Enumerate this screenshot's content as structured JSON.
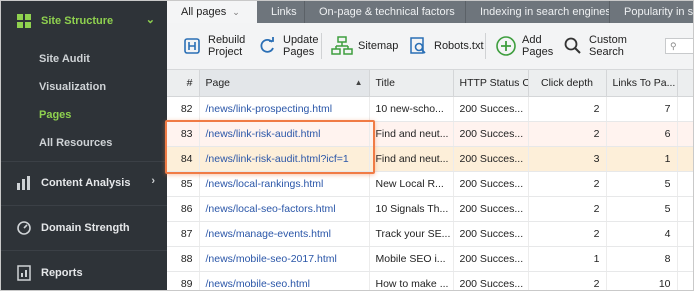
{
  "colors": {
    "accent_green": "#8fd14f",
    "highlight_orange": "#f07b45",
    "link_blue": "#2a56a8",
    "sidebar_bg": "#2e3338"
  },
  "sidebar": {
    "site_structure": {
      "label": "Site Structure",
      "icon": "sitemap-icon"
    },
    "items": [
      {
        "label": "Site Audit",
        "active": false
      },
      {
        "label": "Visualization",
        "active": false
      },
      {
        "label": "Pages",
        "active": true
      },
      {
        "label": "All Resources",
        "active": false
      }
    ],
    "content_analysis": {
      "label": "Content Analysis",
      "icon": "bar-chart-icon"
    },
    "domain_strength": {
      "label": "Domain Strength",
      "icon": "gauge-icon"
    },
    "reports": {
      "label": "Reports",
      "icon": "report-icon"
    }
  },
  "tabs": [
    {
      "label": "All pages",
      "active": true
    },
    {
      "label": "Links"
    },
    {
      "label": "On-page & technical factors"
    },
    {
      "label": "Indexing in search engines"
    },
    {
      "label": "Popularity in s"
    }
  ],
  "toolbar": {
    "rebuild": "Rebuild\nProject",
    "update": "Update\nPages",
    "sitemap": "Sitemap",
    "robots": "Robots.txt",
    "add": "Add\nPages",
    "custom_search": "Custom\nSearch"
  },
  "table": {
    "headers": [
      "#",
      "Page",
      "Title",
      "HTTP Status C...",
      "Click depth",
      "Links To Pa..."
    ],
    "rows": [
      [
        "82",
        "/news/link-prospecting.html",
        "10 new-scho...",
        "200 Succes...",
        "2",
        "7"
      ],
      [
        "83",
        "/news/link-risk-audit.html",
        "Find and neut...",
        "200 Succes...",
        "2",
        "6"
      ],
      [
        "84",
        "/news/link-risk-audit.html?icf=1",
        "Find and neut...",
        "200 Succes...",
        "3",
        "1"
      ],
      [
        "85",
        "/news/local-rankings.html",
        "New Local R...",
        "200 Succes...",
        "2",
        "5"
      ],
      [
        "86",
        "/news/local-seo-factors.html",
        "10 Signals Th...",
        "200 Succes...",
        "2",
        "5"
      ],
      [
        "87",
        "/news/manage-events.html",
        "Track your SE...",
        "200 Succes...",
        "2",
        "4"
      ],
      [
        "88",
        "/news/mobile-seo-2017.html",
        "Mobile SEO i...",
        "200 Succes...",
        "1",
        "8"
      ],
      [
        "89",
        "/news/mobile-seo.html",
        "How to make ...",
        "200 Succes...",
        "2",
        "10"
      ]
    ]
  }
}
